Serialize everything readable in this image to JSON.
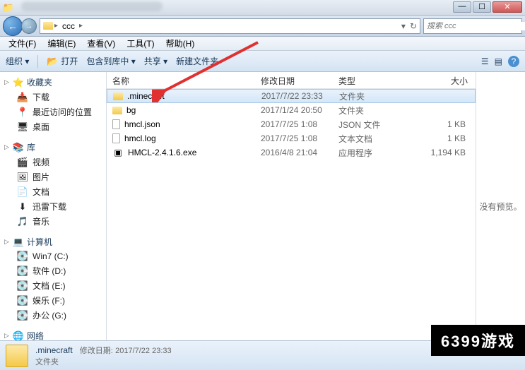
{
  "titlebar": {
    "appicon": "📁"
  },
  "address": {
    "back": "←",
    "fwd": "→",
    "crumbs": [
      "ccc"
    ],
    "dropdown": "▸",
    "search_placeholder": "搜索 ccc",
    "search_icon": "🔍"
  },
  "menubar": [
    "文件(F)",
    "编辑(E)",
    "查看(V)",
    "工具(T)",
    "帮助(H)"
  ],
  "toolbar": {
    "organize": "组织 ▾",
    "open": "打开",
    "include": "包含到库中 ▾",
    "share": "共享 ▾",
    "newfolder": "新建文件夹",
    "view_icon": "☰",
    "preview_icon": "▤",
    "help_icon": "?"
  },
  "sidebar": {
    "favorites": {
      "label": "收藏夹",
      "icon": "⭐",
      "items": [
        {
          "label": "下载",
          "icon": "📥"
        },
        {
          "label": "最近访问的位置",
          "icon": "📍"
        },
        {
          "label": "桌面",
          "icon": "🖥"
        }
      ]
    },
    "libraries": {
      "label": "库",
      "icon": "📚",
      "items": [
        {
          "label": "视频",
          "icon": "🎬"
        },
        {
          "label": "图片",
          "icon": "🖼"
        },
        {
          "label": "文档",
          "icon": "📄"
        },
        {
          "label": "迅雷下载",
          "icon": "⬇"
        },
        {
          "label": "音乐",
          "icon": "🎵"
        }
      ]
    },
    "computer": {
      "label": "计算机",
      "icon": "💻",
      "items": [
        {
          "label": "Win7 (C:)",
          "icon": "💽"
        },
        {
          "label": "软件 (D:)",
          "icon": "💽"
        },
        {
          "label": "文档 (E:)",
          "icon": "💽"
        },
        {
          "label": "娱乐 (F:)",
          "icon": "💽"
        },
        {
          "label": "办公 (G:)",
          "icon": "💽"
        }
      ]
    },
    "network": {
      "label": "网络",
      "icon": "🌐"
    }
  },
  "columns": {
    "name": "名称",
    "date": "修改日期",
    "type": "类型",
    "size": "大小"
  },
  "files": [
    {
      "name": ".minecraft",
      "date": "2017/7/22 23:33",
      "type": "文件夹",
      "size": "",
      "icon": "folder",
      "selected": true
    },
    {
      "name": "bg",
      "date": "2017/1/24 20:50",
      "type": "文件夹",
      "size": "",
      "icon": "folder"
    },
    {
      "name": "hmcl.json",
      "date": "2017/7/25 1:08",
      "type": "JSON 文件",
      "size": "1 KB",
      "icon": "file"
    },
    {
      "name": "hmcl.log",
      "date": "2017/7/25 1:08",
      "type": "文本文档",
      "size": "1 KB",
      "icon": "file"
    },
    {
      "name": "HMCL-2.4.1.6.exe",
      "date": "2016/4/8 21:04",
      "type": "应用程序",
      "size": "1,194 KB",
      "icon": "exe"
    }
  ],
  "preview": {
    "text": "没有预览。"
  },
  "statusbar": {
    "selected_name": ".minecraft",
    "date_label": "修改日期:",
    "date_value": "2017/7/22 23:33",
    "type_line": "文件夹"
  },
  "watermark": "6399游戏"
}
